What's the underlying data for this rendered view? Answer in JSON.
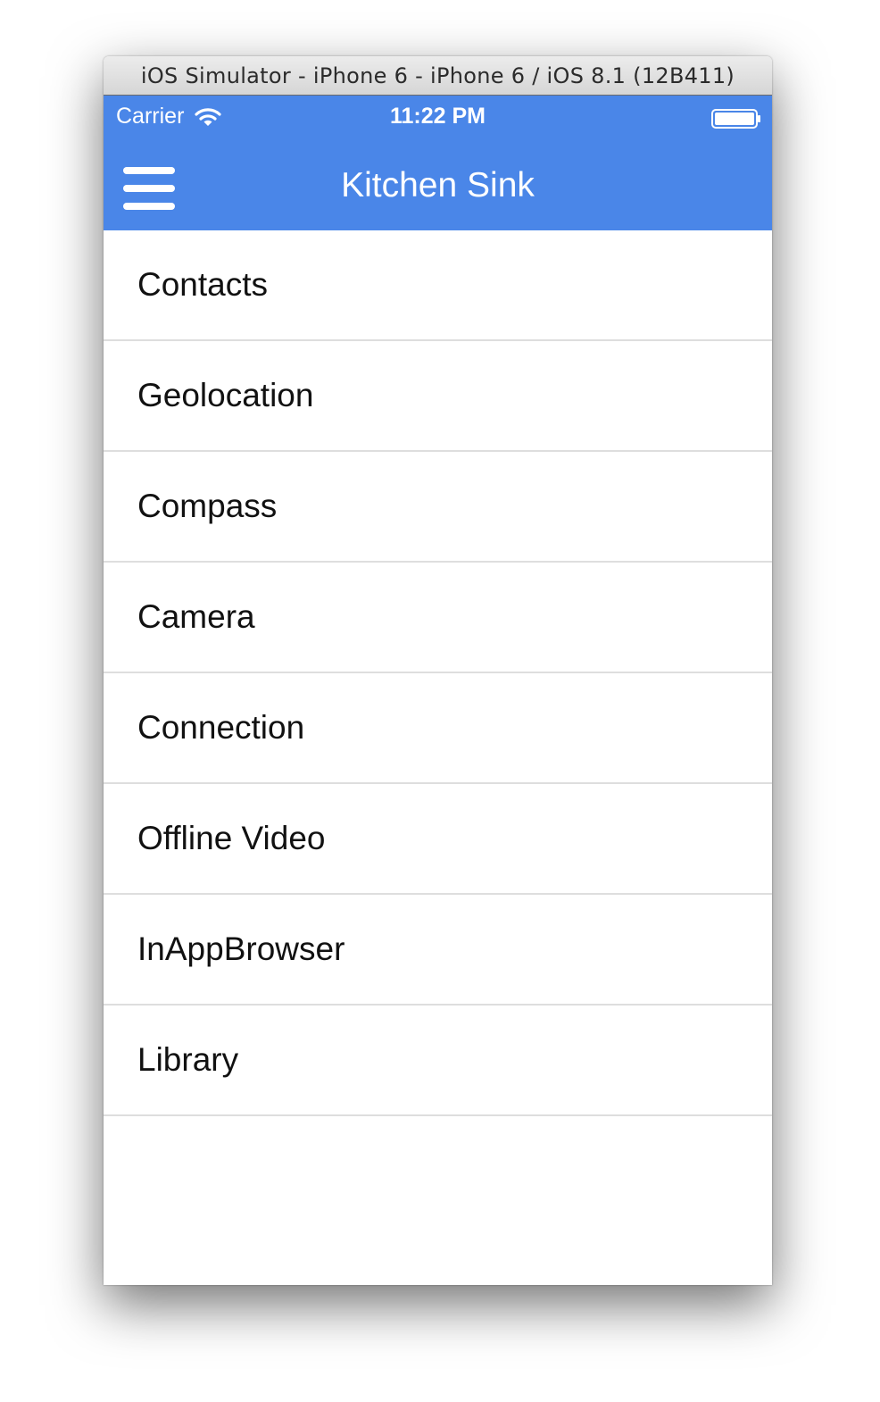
{
  "window": {
    "title": "iOS Simulator - iPhone 6 - iPhone 6 / iOS 8.1 (12B411)"
  },
  "statusbar": {
    "carrier": "Carrier",
    "time": "11:22 PM",
    "wifi_icon": "wifi-icon",
    "battery_icon": "battery-icon"
  },
  "navbar": {
    "title": "Kitchen Sink",
    "menu_icon": "hamburger-menu-icon",
    "background_color": "#4a86e8"
  },
  "menu": {
    "items": [
      {
        "label": "Contacts"
      },
      {
        "label": "Geolocation"
      },
      {
        "label": "Compass"
      },
      {
        "label": "Camera"
      },
      {
        "label": "Connection"
      },
      {
        "label": "Offline Video"
      },
      {
        "label": "InAppBrowser"
      },
      {
        "label": "Library"
      }
    ]
  }
}
